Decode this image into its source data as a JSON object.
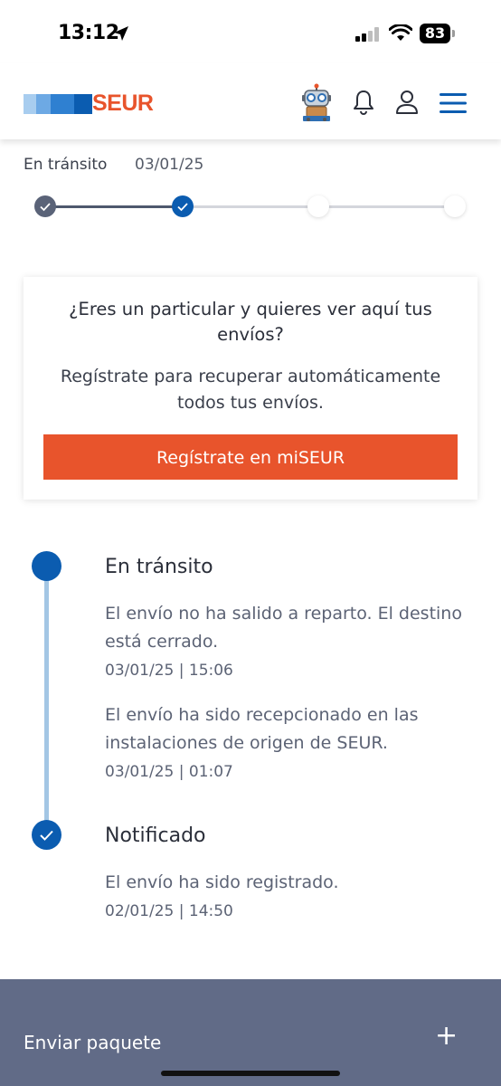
{
  "status_bar": {
    "time": "13:12",
    "battery": "83"
  },
  "header": {
    "logo_text": "SEUR"
  },
  "progress": {
    "status_label": "En tránsito",
    "date": "03/01/25",
    "completed_fraction": 0.33
  },
  "register_card": {
    "title": "¿Eres un particular y quieres ver aquí tus envíos?",
    "body": "Regístrate para recuperar automáticamente todos tus envíos.",
    "button_label": "Regístrate en miSEUR"
  },
  "timeline": {
    "groups": [
      {
        "title": "En tránsito",
        "events": [
          {
            "text": "El envío no ha salido a reparto. El destino está cerrado.",
            "datetime": "03/01/25 | 15:06"
          },
          {
            "text": "El envío ha sido recepcionado en las instalaciones de origen de SEUR.",
            "datetime": "03/01/25 | 01:07"
          }
        ]
      },
      {
        "title": "Notificado",
        "events": [
          {
            "text": "El envío ha sido registrado.",
            "datetime": "02/01/25 | 14:50"
          }
        ]
      }
    ]
  },
  "footer": {
    "send_label": "Enviar paquete",
    "expand_symbol": "+"
  },
  "colors": {
    "brand_orange": "#e8542c",
    "brand_blue": "#0b5cb0",
    "timeline_line": "#a3c6e4",
    "footer_bg": "#616b87"
  }
}
